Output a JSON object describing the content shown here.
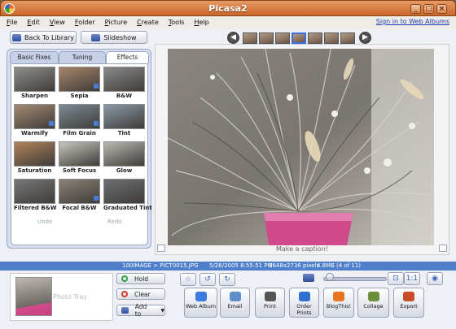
{
  "window": {
    "title": "Picasa2",
    "controls": [
      "_",
      "□",
      "×"
    ]
  },
  "menu": [
    {
      "accel": "F",
      "rest": "ile"
    },
    {
      "accel": "E",
      "rest": "dit"
    },
    {
      "accel": "V",
      "rest": "iew"
    },
    {
      "accel": "F",
      "rest": "older"
    },
    {
      "accel": "P",
      "rest": "icture"
    },
    {
      "accel": "C",
      "rest": "reate"
    },
    {
      "accel": "T",
      "rest": "ools"
    },
    {
      "accel": "H",
      "rest": "elp"
    }
  ],
  "signin_link": "Sign in to Web Albums",
  "toolbar": {
    "back_label": "Back To Library",
    "slideshow_label": "Slideshow"
  },
  "tabs": [
    {
      "label": "Basic Fixes",
      "active": false
    },
    {
      "label": "Tuning",
      "active": false
    },
    {
      "label": "Effects",
      "active": true
    }
  ],
  "effects": [
    {
      "label": "Sharpen",
      "tint": "#8f8f8c"
    },
    {
      "label": "Sepia",
      "tint": "#a8856a"
    },
    {
      "label": "B&W",
      "tint": "#8a8a8a"
    },
    {
      "label": "Warmify",
      "tint": "#a58a73"
    },
    {
      "label": "Film Grain",
      "tint": "#7b8a94"
    },
    {
      "label": "Tint",
      "tint": "#8b9aa8"
    },
    {
      "label": "Saturation",
      "tint": "#b0835a"
    },
    {
      "label": "Soft Focus",
      "tint": "#c9c4bd"
    },
    {
      "label": "Glow",
      "tint": "#bcb8b3"
    },
    {
      "label": "Filtered B&W",
      "tint": "#777"
    },
    {
      "label": "Focal B&W",
      "tint": "#8c8276"
    },
    {
      "label": "Graduated Tint",
      "tint": "#6e6f73"
    }
  ],
  "undo_label": "Undo",
  "redo_label": "Redo",
  "caption_placeholder": "Make a caption!",
  "info": {
    "path": "100IMAGE > PICT0015.JPG",
    "date": "5/26/2005 8:55:51 PM",
    "dims": "3648x2736 pixels",
    "size": "4.8MB",
    "position": "(4 of 11)"
  },
  "tray": {
    "label": "Photo Tray",
    "hold": "Hold",
    "clear": "Clear",
    "add_to": "Add to"
  },
  "actions": [
    {
      "label": "Web Album",
      "color": "#3a7be0"
    },
    {
      "label": "Email",
      "color": "#5e8ec9"
    },
    {
      "label": "Print",
      "color": "#555"
    },
    {
      "label": "Order Prints",
      "color": "#2e6fd0"
    },
    {
      "label": "BlogThis!",
      "color": "#e8741f"
    },
    {
      "label": "Collage",
      "color": "#6b8f3a"
    },
    {
      "label": "Export",
      "color": "#c84b2a"
    }
  ],
  "zoom_level": 0.1
}
